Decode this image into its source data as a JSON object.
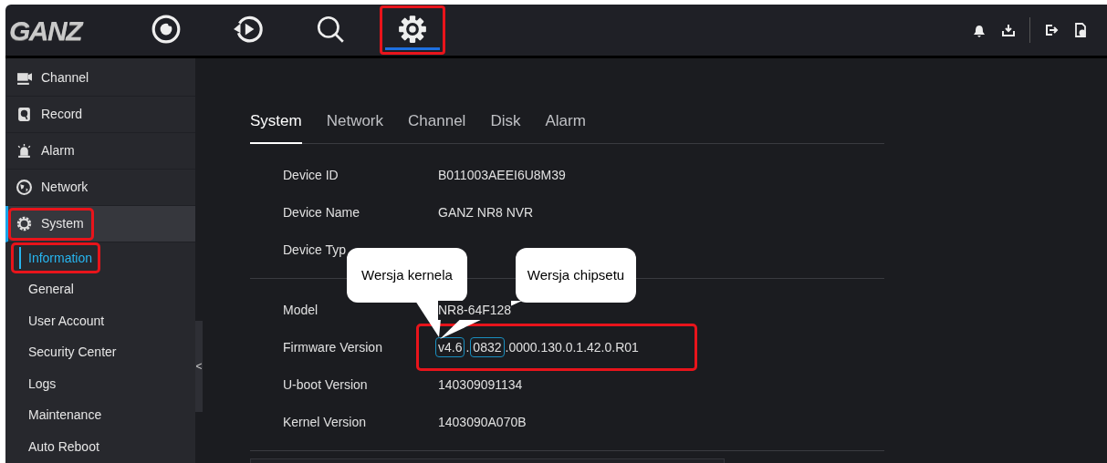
{
  "header": {
    "logo": "GANZ",
    "nav": [
      {
        "kind": "live",
        "selected": false,
        "highlighted": false
      },
      {
        "kind": "playback",
        "selected": false,
        "highlighted": false
      },
      {
        "kind": "search",
        "selected": false,
        "highlighted": false
      },
      {
        "kind": "settings",
        "selected": true,
        "highlighted": true
      }
    ],
    "tools": [
      {
        "kind": "bell"
      },
      {
        "kind": "download"
      },
      {
        "kind": "logout"
      },
      {
        "kind": "help"
      }
    ]
  },
  "sidebar": {
    "items": [
      {
        "label": "Channel",
        "selected": false,
        "highlighted": false
      },
      {
        "label": "Record",
        "selected": false,
        "highlighted": false
      },
      {
        "label": "Alarm",
        "selected": false,
        "highlighted": false
      },
      {
        "label": "Network",
        "selected": false,
        "highlighted": false
      },
      {
        "label": "System",
        "selected": true,
        "highlighted": true,
        "children": [
          {
            "label": "Information",
            "selected": true,
            "highlighted": true
          },
          {
            "label": "General",
            "selected": false,
            "highlighted": false
          },
          {
            "label": "User Account",
            "selected": false,
            "highlighted": false
          },
          {
            "label": "Security Center",
            "selected": false,
            "highlighted": false
          },
          {
            "label": "Logs",
            "selected": false,
            "highlighted": false
          },
          {
            "label": "Maintenance",
            "selected": false,
            "highlighted": false
          },
          {
            "label": "Auto Reboot",
            "selected": false,
            "highlighted": false
          }
        ]
      }
    ],
    "collapse": "<"
  },
  "tabs": [
    {
      "label": "System",
      "selected": true
    },
    {
      "label": "Network",
      "selected": false
    },
    {
      "label": "Channel",
      "selected": false
    },
    {
      "label": "Disk",
      "selected": false
    },
    {
      "label": "Alarm",
      "selected": false
    }
  ],
  "groups": [
    [
      {
        "label": "Device ID",
        "value": "B011003AEEI6U8M39"
      },
      {
        "label": "Device Name",
        "value": "GANZ NR8 NVR"
      },
      {
        "label": "Device Typ"
      }
    ],
    [
      {
        "label": "Model",
        "value": "NR8-64F128"
      },
      {
        "label": "Firmware Version",
        "highlighted": true,
        "segments": [
          {
            "text": "v4.6",
            "boxed": true
          },
          {
            "text": ".",
            "boxed": false
          },
          {
            "text": "0832",
            "boxed": true
          },
          {
            "text": ".0000.130.0.1.42.0.R01",
            "boxed": false
          }
        ]
      },
      {
        "label": "U-boot Version",
        "value": "140309091134"
      },
      {
        "label": "Kernel Version",
        "value": "1403090A070B"
      }
    ]
  ],
  "callouts": [
    {
      "text": "Wersja kernela"
    },
    {
      "text": "Wersja chipsetu"
    }
  ]
}
